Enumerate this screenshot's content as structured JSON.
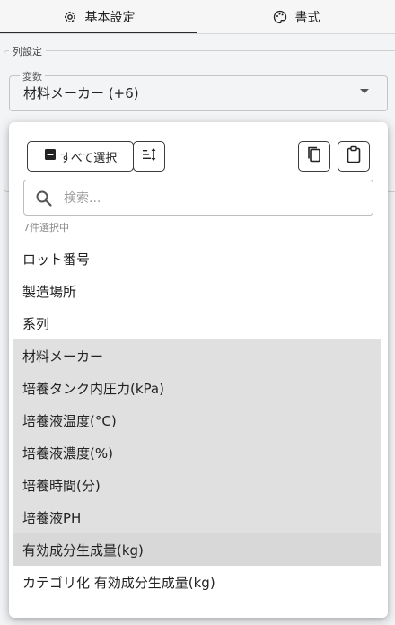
{
  "tabs": [
    {
      "label": "基本設定",
      "icon": "gear-icon",
      "active": true
    },
    {
      "label": "書式",
      "icon": "palette-icon",
      "active": false
    }
  ],
  "column_settings": {
    "legend": "列設定",
    "variable_label": "変数",
    "variable_value": "材料メーカー (+6)"
  },
  "popup": {
    "select_all_label": "すべて選択",
    "search_placeholder": "検索...",
    "selected_count": "7件選択中",
    "items": [
      {
        "label": "ロット番号",
        "selected": false
      },
      {
        "label": "製造場所",
        "selected": false
      },
      {
        "label": "系列",
        "selected": false
      },
      {
        "label": "材料メーカー",
        "selected": true
      },
      {
        "label": "培養タンク内圧力(kPa)",
        "selected": true
      },
      {
        "label": "培養液温度(°C)",
        "selected": true
      },
      {
        "label": "培養液濃度(%)",
        "selected": true
      },
      {
        "label": "培養時間(分)",
        "selected": true
      },
      {
        "label": "培養液PH",
        "selected": true
      },
      {
        "label": "有効成分生成量(kg)",
        "selected": true
      },
      {
        "label": "カテゴリ化 有効成分生成量(kg)",
        "selected": false
      }
    ]
  }
}
